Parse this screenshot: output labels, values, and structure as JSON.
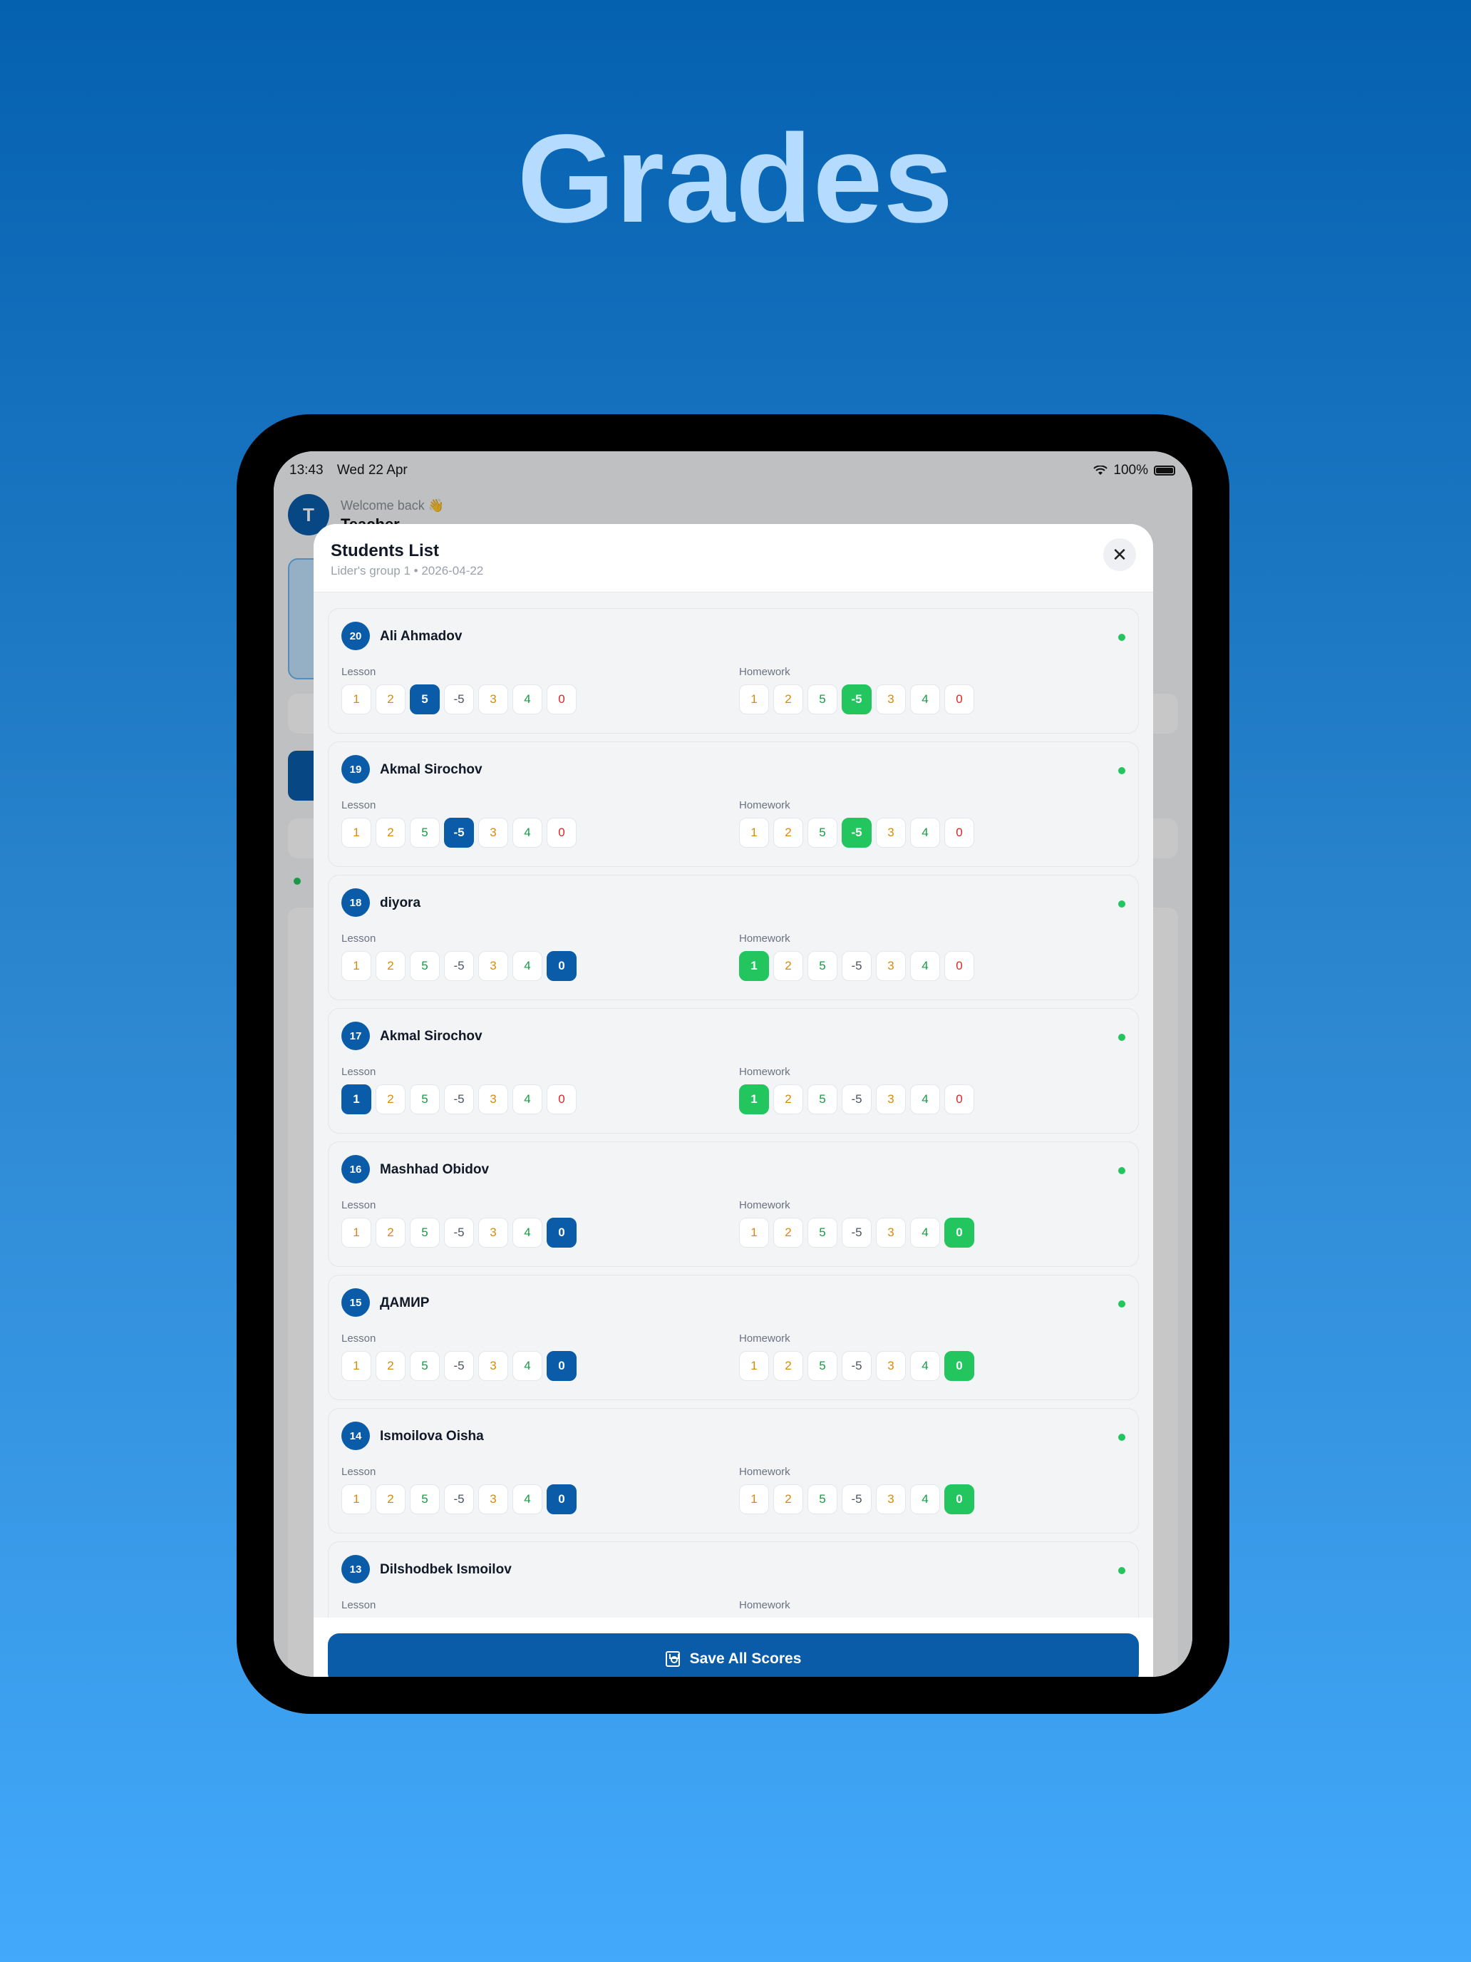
{
  "headline": "Grades",
  "status_bar": {
    "time": "13:43",
    "date": "Wed 22 Apr",
    "battery": "100%"
  },
  "background_app": {
    "avatar_letter": "T",
    "welcome": "Welcome back 👋",
    "name": "Teacher"
  },
  "modal": {
    "title": "Students List",
    "subtitle": "Lider's group 1 • 2026-04-22",
    "close_label": "✕",
    "lesson_label": "Lesson",
    "homework_label": "Homework",
    "save_label": "Save All Scores"
  },
  "grade_options": [
    "1",
    "2",
    "5",
    "-5",
    "3",
    "4",
    "0"
  ],
  "students": [
    {
      "number": "20",
      "name": "Ali Ahmadov",
      "lesson_selected": "5",
      "homework_selected": "-5"
    },
    {
      "number": "19",
      "name": "Akmal Sirochov",
      "lesson_selected": "-5",
      "homework_selected": "-5"
    },
    {
      "number": "18",
      "name": "diyora",
      "lesson_selected": "0",
      "homework_selected": "1"
    },
    {
      "number": "17",
      "name": "Akmal Sirochov",
      "lesson_selected": "1",
      "homework_selected": "1"
    },
    {
      "number": "16",
      "name": "Mashhad Obidov",
      "lesson_selected": "0",
      "homework_selected": "0"
    },
    {
      "number": "15",
      "name": "ДАМИР",
      "lesson_selected": "0",
      "homework_selected": "0"
    },
    {
      "number": "14",
      "name": "Ismoilova Oisha",
      "lesson_selected": "0",
      "homework_selected": "0"
    },
    {
      "number": "13",
      "name": "Dilshodbek Ismoilov",
      "lesson_selected": "",
      "homework_selected": ""
    }
  ],
  "colors": {
    "primary": "#0a5ba8",
    "homework_selected": "#22c55e",
    "online_dot": "#22c55e"
  }
}
